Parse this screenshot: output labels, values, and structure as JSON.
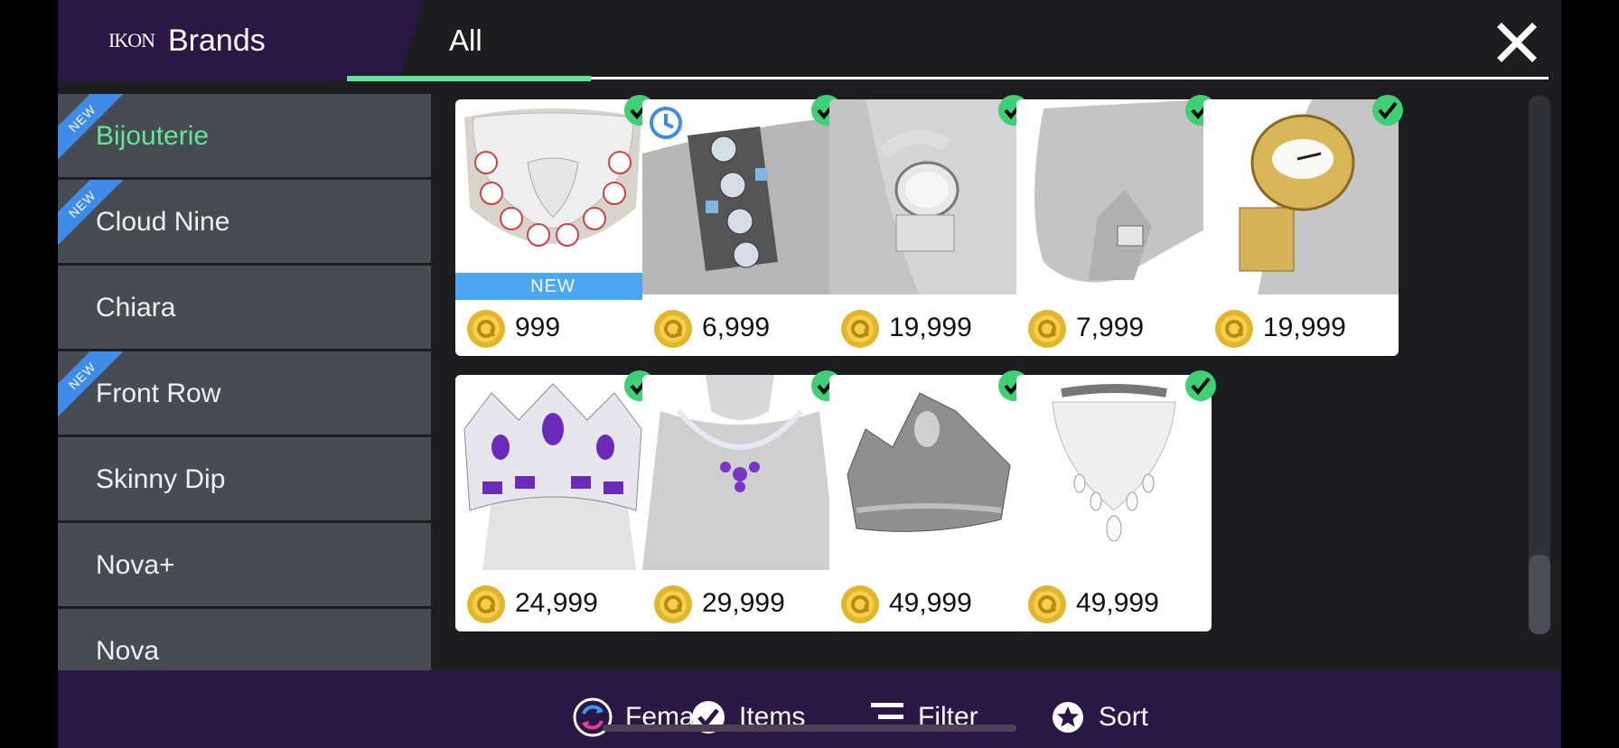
{
  "header": {
    "logo_text": "IKON",
    "title": "Brands",
    "tab_label": "All",
    "close_icon": "close-icon"
  },
  "sidebar": {
    "items": [
      {
        "label": "Bijouterie",
        "is_new": true,
        "active": true
      },
      {
        "label": "Cloud Nine",
        "is_new": true,
        "active": false
      },
      {
        "label": "Chiara",
        "is_new": false,
        "active": false
      },
      {
        "label": "Front Row",
        "is_new": true,
        "active": false
      },
      {
        "label": "Skinny Dip",
        "is_new": false,
        "active": false
      },
      {
        "label": "Nova+",
        "is_new": false,
        "active": false
      },
      {
        "label": "Nova",
        "is_new": false,
        "active": false
      }
    ],
    "new_badge": "NEW"
  },
  "items": [
    {
      "price": "999",
      "image": "diamond-collar-necklace",
      "owned": true,
      "new": true,
      "new_label": "NEW",
      "timed": false
    },
    {
      "price": "6,999",
      "image": "gem-bracelet",
      "owned": true,
      "new": false,
      "timed": true
    },
    {
      "price": "19,999",
      "image": "diamond-watch",
      "owned": true,
      "new": false,
      "timed": false
    },
    {
      "price": "7,999",
      "image": "diamond-ring",
      "owned": true,
      "new": false,
      "timed": false
    },
    {
      "price": "19,999",
      "image": "gold-watch",
      "owned": true,
      "new": false,
      "timed": false
    },
    {
      "price": "24,999",
      "image": "amethyst-crown",
      "owned": true,
      "new": false,
      "timed": false
    },
    {
      "price": "29,999",
      "image": "amethyst-necklace",
      "owned": true,
      "new": false,
      "timed": false
    },
    {
      "price": "49,999",
      "image": "silver-tiara",
      "owned": true,
      "new": false,
      "timed": false
    },
    {
      "price": "49,999",
      "image": "diamond-bib-necklace",
      "owned": true,
      "new": false,
      "timed": false
    }
  ],
  "bottom_bar": {
    "gender_label": "Female",
    "items_label": "Items",
    "filter_label": "Filter",
    "sort_label": "Sort"
  },
  "colors": {
    "accent_green": "#5fe59a",
    "header_purple": "#2a1746",
    "new_blue": "#4aa8f2",
    "check_green": "#3fcf74",
    "coin_gold": "#e3b52a"
  }
}
